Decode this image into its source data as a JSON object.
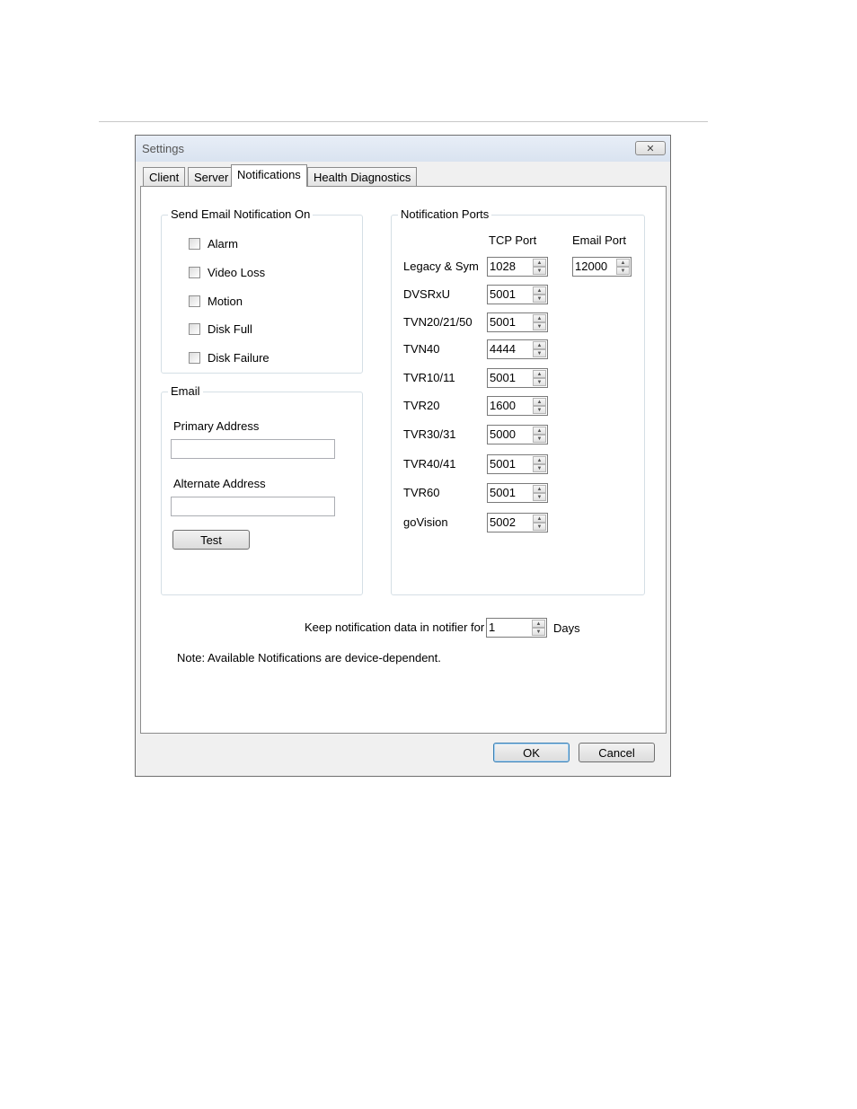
{
  "window": {
    "title": "Settings",
    "close_glyph": "✕"
  },
  "tabs": [
    "Client",
    "Server",
    "Notifications",
    "Health Diagnostics"
  ],
  "active_tab": "Notifications",
  "send_email": {
    "legend": "Send Email Notification On",
    "options": [
      {
        "label": "Alarm",
        "checked": false
      },
      {
        "label": "Video Loss",
        "checked": false
      },
      {
        "label": "Motion",
        "checked": false
      },
      {
        "label": "Disk Full",
        "checked": false
      },
      {
        "label": "Disk Failure",
        "checked": false
      }
    ]
  },
  "email": {
    "legend": "Email",
    "primary_label": "Primary Address",
    "primary_value": "",
    "alternate_label": "Alternate Address",
    "alternate_value": "",
    "test_button": "Test"
  },
  "ports": {
    "legend": "Notification Ports",
    "tcp_header": "TCP Port",
    "email_header": "Email Port",
    "rows": [
      {
        "device": "Legacy & Sym",
        "tcp": "1028",
        "email": "12000"
      },
      {
        "device": "DVSRxU",
        "tcp": "5001"
      },
      {
        "device": "TVN20/21/50",
        "tcp": "5001"
      },
      {
        "device": "TVN40",
        "tcp": "4444"
      },
      {
        "device": "TVR10/11",
        "tcp": "5001"
      },
      {
        "device": "TVR20",
        "tcp": "1600"
      },
      {
        "device": "TVR30/31",
        "tcp": "5000"
      },
      {
        "device": "TVR40/41",
        "tcp": "5001"
      },
      {
        "device": "TVR60",
        "tcp": "5001"
      },
      {
        "device": "goVision",
        "tcp": "5002"
      }
    ]
  },
  "keep": {
    "label": "Keep notification data in notifier for",
    "value": "1",
    "unit": "Days"
  },
  "note": "Note:  Available Notifications are device-dependent.",
  "buttons": {
    "ok": "OK",
    "cancel": "Cancel"
  },
  "icons": {
    "spin_up": "▲",
    "spin_down": "▼"
  }
}
